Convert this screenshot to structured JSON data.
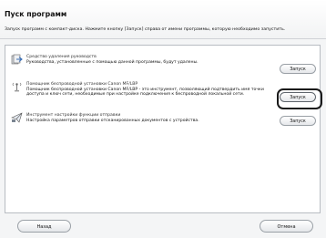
{
  "window": {
    "title": "Пуск программ",
    "subtitle": "Запуск программ с компакт-диска. Нажмите кнопку [Запуск] справа от имени программы, которую необходимо запустить."
  },
  "programs": [
    {
      "name": "Средство удаления руководств",
      "description": "Руководства, установленные с помощью данной программы, будут удалены.",
      "button_label": "Запуск",
      "icon": "uninstall-icon"
    },
    {
      "name": "Помощник беспроводной установки Canon MF/LBP",
      "description": "Помощник беспроводной установки Canon MF/LBP - это инструмент, позволяющий подтвердить имя точки доступа и ключ сети, необходимые при настройке подключения к беспроводной локальной сети.",
      "button_label": "Запуск",
      "icon": "wireless-icon",
      "selected": true
    },
    {
      "name": "Инструмент настройки функции отправки",
      "description": "Настройка параметров отправки отсканированных документов с устройства.",
      "button_label": "Запуск",
      "icon": "send-tool-icon"
    }
  ],
  "footer": {
    "back_label": "Назад",
    "cancel_label": "Отмена"
  },
  "colors": {
    "background": "#f4f5f6",
    "panel": "#ffffff",
    "highlight_frame": "#1a1a1a"
  }
}
